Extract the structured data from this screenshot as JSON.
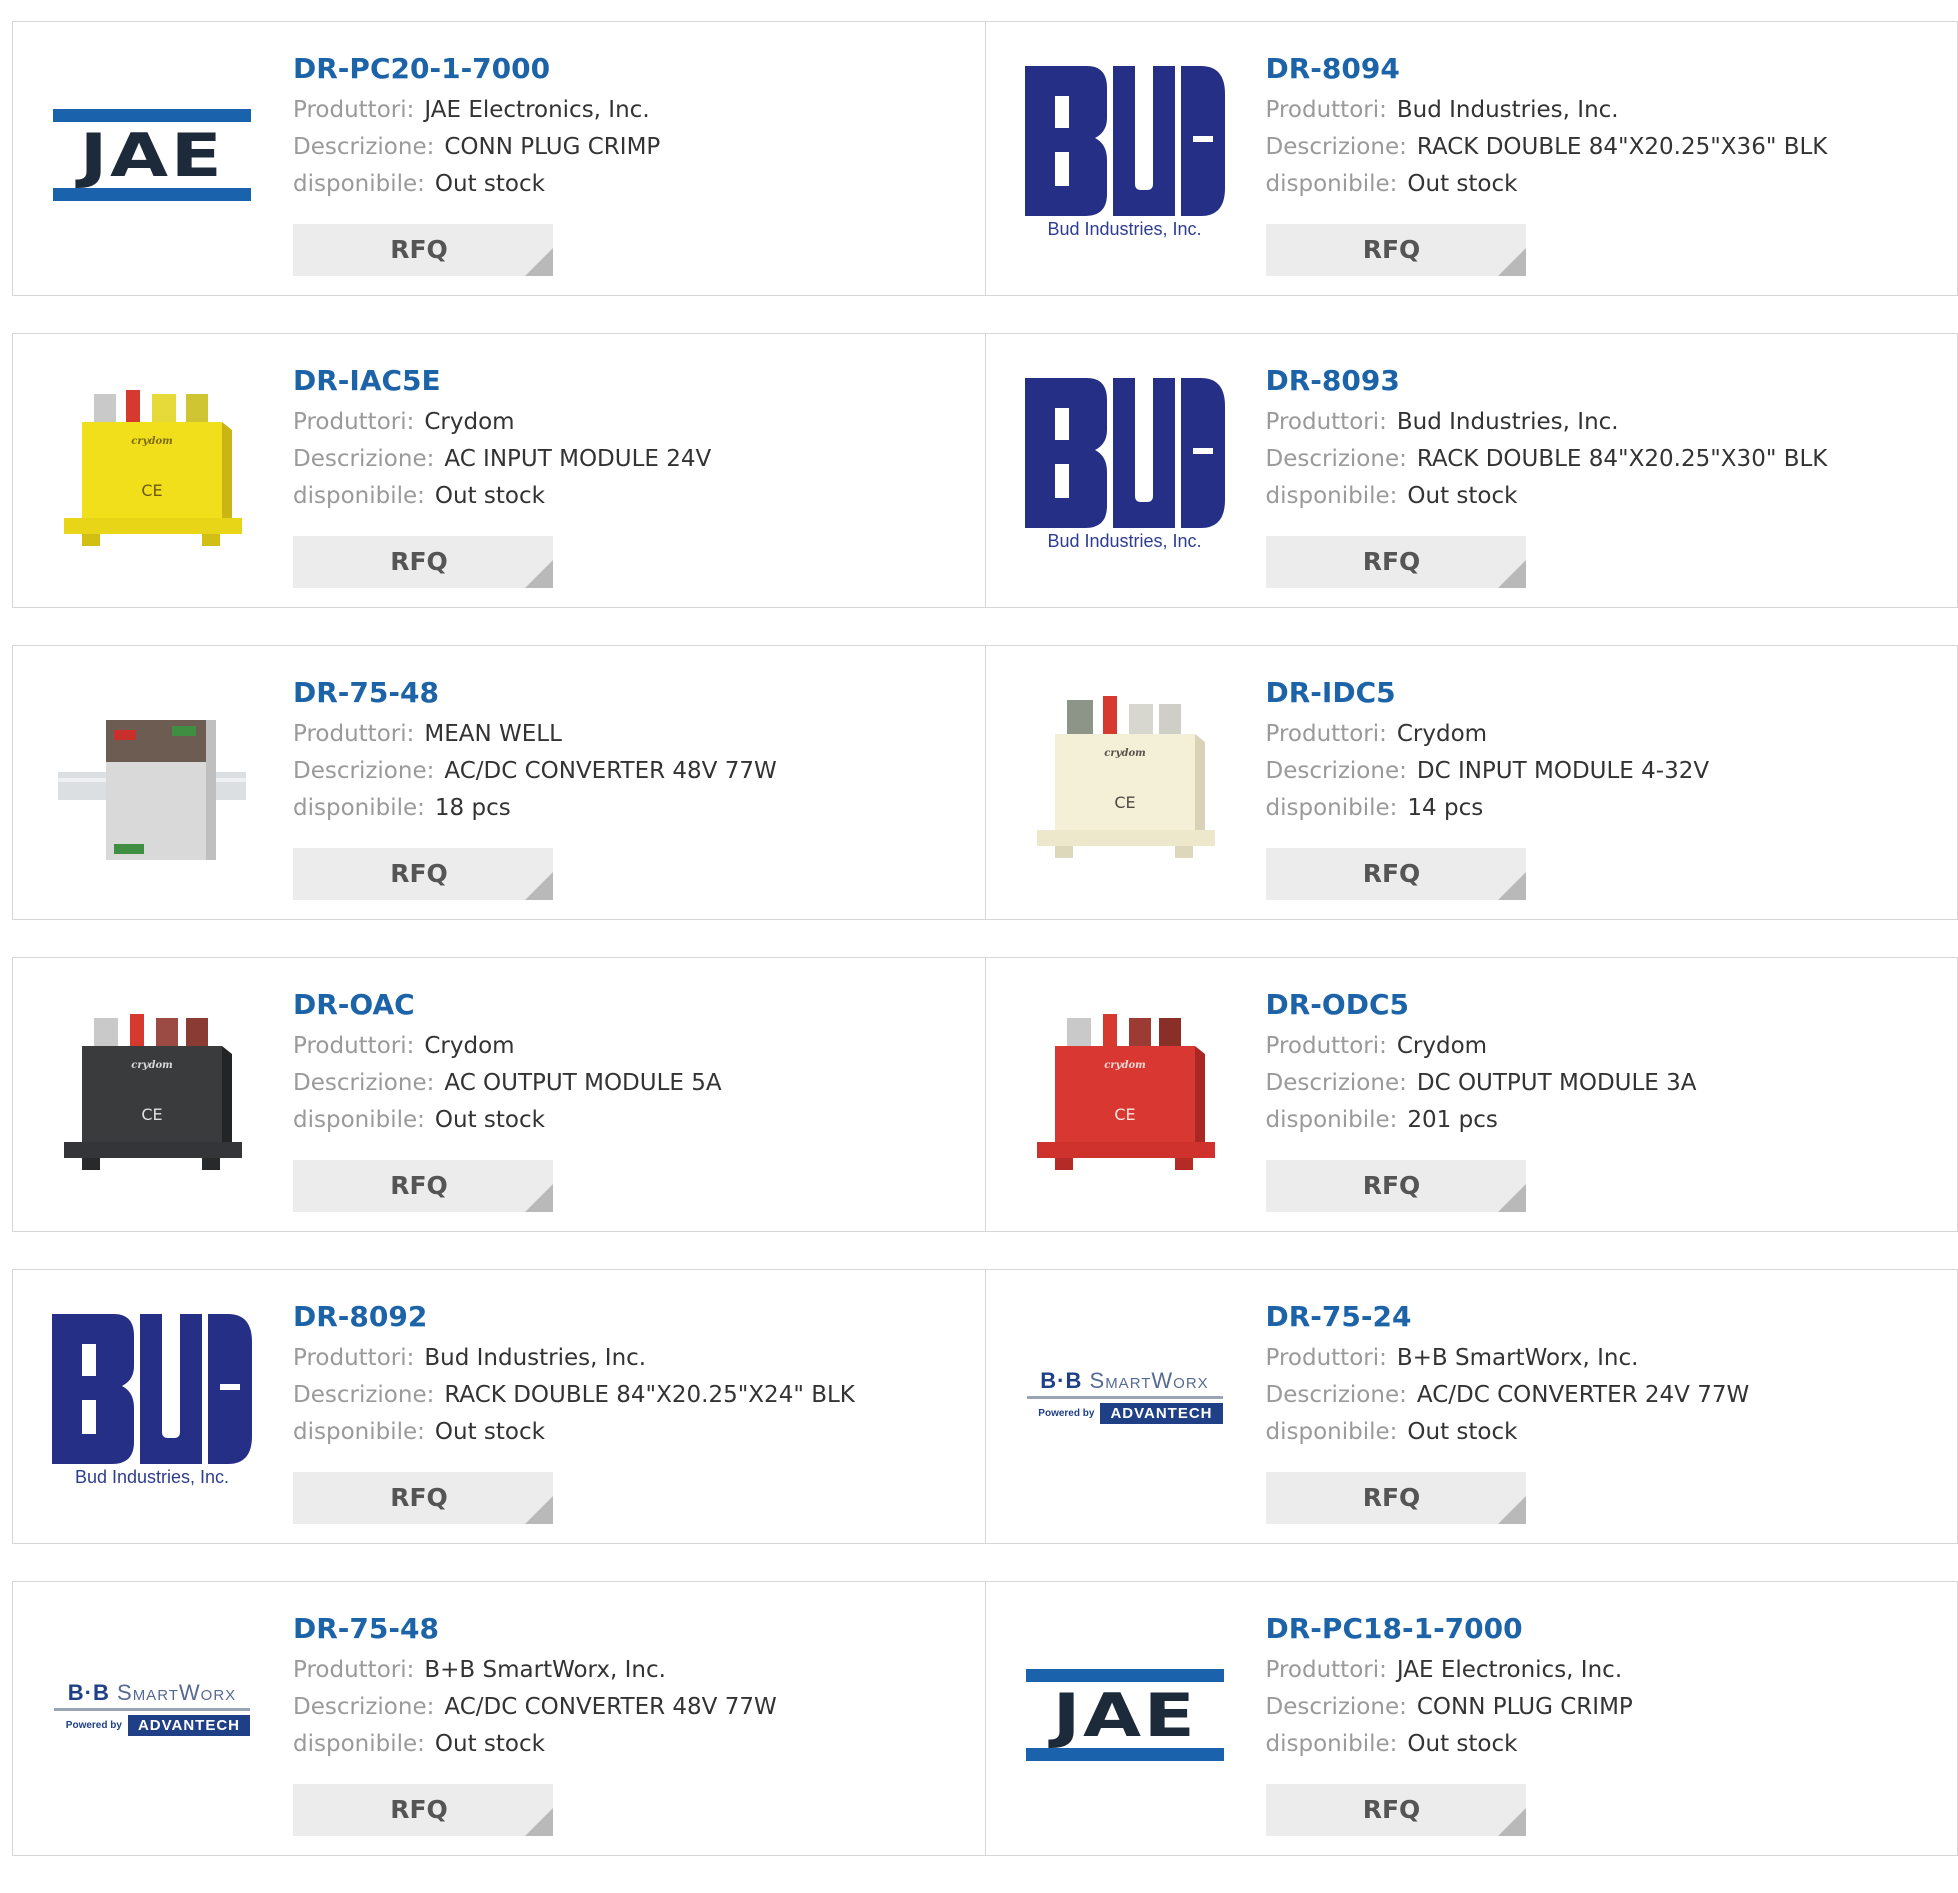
{
  "labels": {
    "manufacturer": "Produttori:",
    "description": "Descrizione:",
    "availability": "disponibile:",
    "rfq": "RFQ"
  },
  "colors": {
    "part_link": "#1d63a8",
    "label": "#9a9a9a",
    "value": "#333333",
    "rfq_bg": "#ececec"
  },
  "products": [
    {
      "part": "DR-PC20-1-7000",
      "manufacturer": "JAE Electronics, Inc.",
      "description": "CONN PLUG CRIMP",
      "availability": "Out stock",
      "image": "jae-logo"
    },
    {
      "part": "DR-8094",
      "manufacturer": "Bud Industries, Inc.",
      "description": "RACK DOUBLE 84\"X20.25\"X36\" BLK",
      "availability": "Out stock",
      "image": "bud-industries-logo"
    },
    {
      "part": "DR-IAC5E",
      "manufacturer": "Crydom",
      "description": "AC INPUT MODULE 24V",
      "availability": "Out stock",
      "image": "yellow-crydom-module-photo"
    },
    {
      "part": "DR-8093",
      "manufacturer": "Bud Industries, Inc.",
      "description": "RACK DOUBLE 84\"X20.25\"X30\" BLK",
      "availability": "Out stock",
      "image": "bud-industries-logo"
    },
    {
      "part": "DR-75-48",
      "manufacturer": "MEAN WELL",
      "description": "AC/DC CONVERTER 48V 77W",
      "availability": "18 pcs",
      "image": "din-rail-power-supply-photo"
    },
    {
      "part": "DR-IDC5",
      "manufacturer": "Crydom",
      "description": "DC INPUT MODULE 4-32V",
      "availability": "14 pcs",
      "image": "white-crydom-module-photo"
    },
    {
      "part": "DR-OAC",
      "manufacturer": "Crydom",
      "description": "AC OUTPUT MODULE 5A",
      "availability": "Out stock",
      "image": "black-crydom-module-photo"
    },
    {
      "part": "DR-ODC5",
      "manufacturer": "Crydom",
      "description": "DC OUTPUT MODULE 3A",
      "availability": "201 pcs",
      "image": "red-crydom-module-photo"
    },
    {
      "part": "DR-8092",
      "manufacturer": "Bud Industries, Inc.",
      "description": "RACK DOUBLE 84\"X20.25\"X24\" BLK",
      "availability": "Out stock",
      "image": "bud-industries-logo"
    },
    {
      "part": "DR-75-24",
      "manufacturer": "B+B SmartWorx, Inc.",
      "description": "AC/DC CONVERTER 24V 77W",
      "availability": "Out stock",
      "image": "bb-smartworx-logo"
    },
    {
      "part": "DR-75-48",
      "manufacturer": "B+B SmartWorx, Inc.",
      "description": "AC/DC CONVERTER 48V 77W",
      "availability": "Out stock",
      "image": "bb-smartworx-logo"
    },
    {
      "part": "DR-PC18-1-7000",
      "manufacturer": "JAE Electronics, Inc.",
      "description": "CONN PLUG CRIMP",
      "availability": "Out stock",
      "image": "jae-logo"
    }
  ],
  "logos": {
    "jae": "JAE",
    "bud_caption": "Bud Industries, Inc.",
    "bb_top_1": "B·B ",
    "bb_top_2": "SmartWorx",
    "bb_powered": "Powered by",
    "bb_adv": "ADVANTECH"
  }
}
